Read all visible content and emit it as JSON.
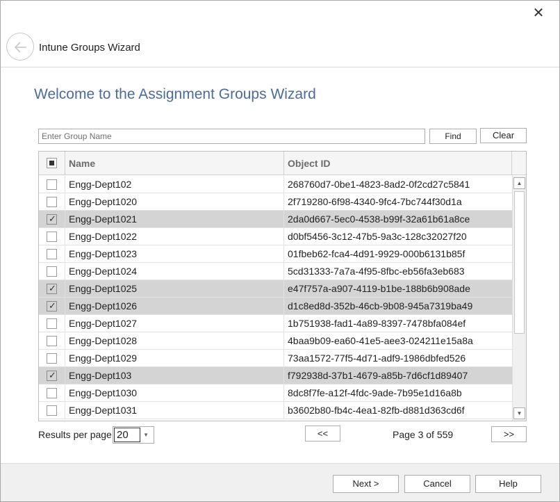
{
  "window": {
    "title": "Intune Groups Wizard",
    "close_glyph": "✕"
  },
  "wizard": {
    "heading": "Welcome to the Assignment Groups Wizard"
  },
  "search": {
    "placeholder": "Enter Group Name",
    "value": "",
    "find_label": "Find",
    "clear_label": "Clear"
  },
  "grid": {
    "columns": {
      "name": "Name",
      "object_id": "Object ID"
    },
    "rows": [
      {
        "checked": false,
        "name": "Engg-Dept102",
        "object_id": "268760d7-0be1-4823-8ad2-0f2cd27c5841"
      },
      {
        "checked": false,
        "name": "Engg-Dept1020",
        "object_id": "2f719280-6f98-4340-9fc4-7bc744f30d1a"
      },
      {
        "checked": true,
        "name": "Engg-Dept1021",
        "object_id": "2da0d667-5ec0-4538-b99f-32a61b61a8ce"
      },
      {
        "checked": false,
        "name": "Engg-Dept1022",
        "object_id": "d0bf5456-3c12-47b5-9a3c-128c32027f20"
      },
      {
        "checked": false,
        "name": "Engg-Dept1023",
        "object_id": "01fbeb62-fca4-4d91-9929-000b6131b85f"
      },
      {
        "checked": false,
        "name": "Engg-Dept1024",
        "object_id": "5cd31333-7a7a-4f95-8fbc-eb56fa3eb683"
      },
      {
        "checked": true,
        "name": "Engg-Dept1025",
        "object_id": "e47f757a-a907-4119-b1be-188b6b908ade"
      },
      {
        "checked": true,
        "name": "Engg-Dept1026",
        "object_id": "d1c8ed8d-352b-46cb-9b08-945a7319ba49"
      },
      {
        "checked": false,
        "name": "Engg-Dept1027",
        "object_id": "1b751938-fad1-4a89-8397-7478bfa084ef"
      },
      {
        "checked": false,
        "name": "Engg-Dept1028",
        "object_id": "4baa9b09-ea60-41e5-aee3-024211e15a8a"
      },
      {
        "checked": false,
        "name": "Engg-Dept1029",
        "object_id": "73aa1572-77f5-4d71-adf9-1986dbfed526"
      },
      {
        "checked": true,
        "name": "Engg-Dept103",
        "object_id": "f792938d-37b1-4679-a85b-7d6cf1d89407"
      },
      {
        "checked": false,
        "name": "Engg-Dept1030",
        "object_id": "8dc8f7fe-a12f-4fdc-9ade-7b95e1d16a8b"
      },
      {
        "checked": false,
        "name": "Engg-Dept1031",
        "object_id": "b3602b80-fb4c-4ea1-82fb-d881d363cd6f"
      }
    ]
  },
  "pagination": {
    "results_per_page_label": "Results per page",
    "results_per_page_value": "20",
    "prev_label": "<<",
    "next_label": ">>",
    "page_info": "Page 3 of 559"
  },
  "footer": {
    "next_label": "Next >",
    "cancel_label": "Cancel",
    "help_label": "Help"
  },
  "colors": {
    "heading": "#4a6b9c",
    "selected_row": "#d4d4d4",
    "footer_bg": "#f0f0f0"
  },
  "icons": {
    "back": "back-arrow-icon",
    "close": "close-icon",
    "check": "checkmark-icon",
    "dropdown": "chevron-down-icon"
  }
}
